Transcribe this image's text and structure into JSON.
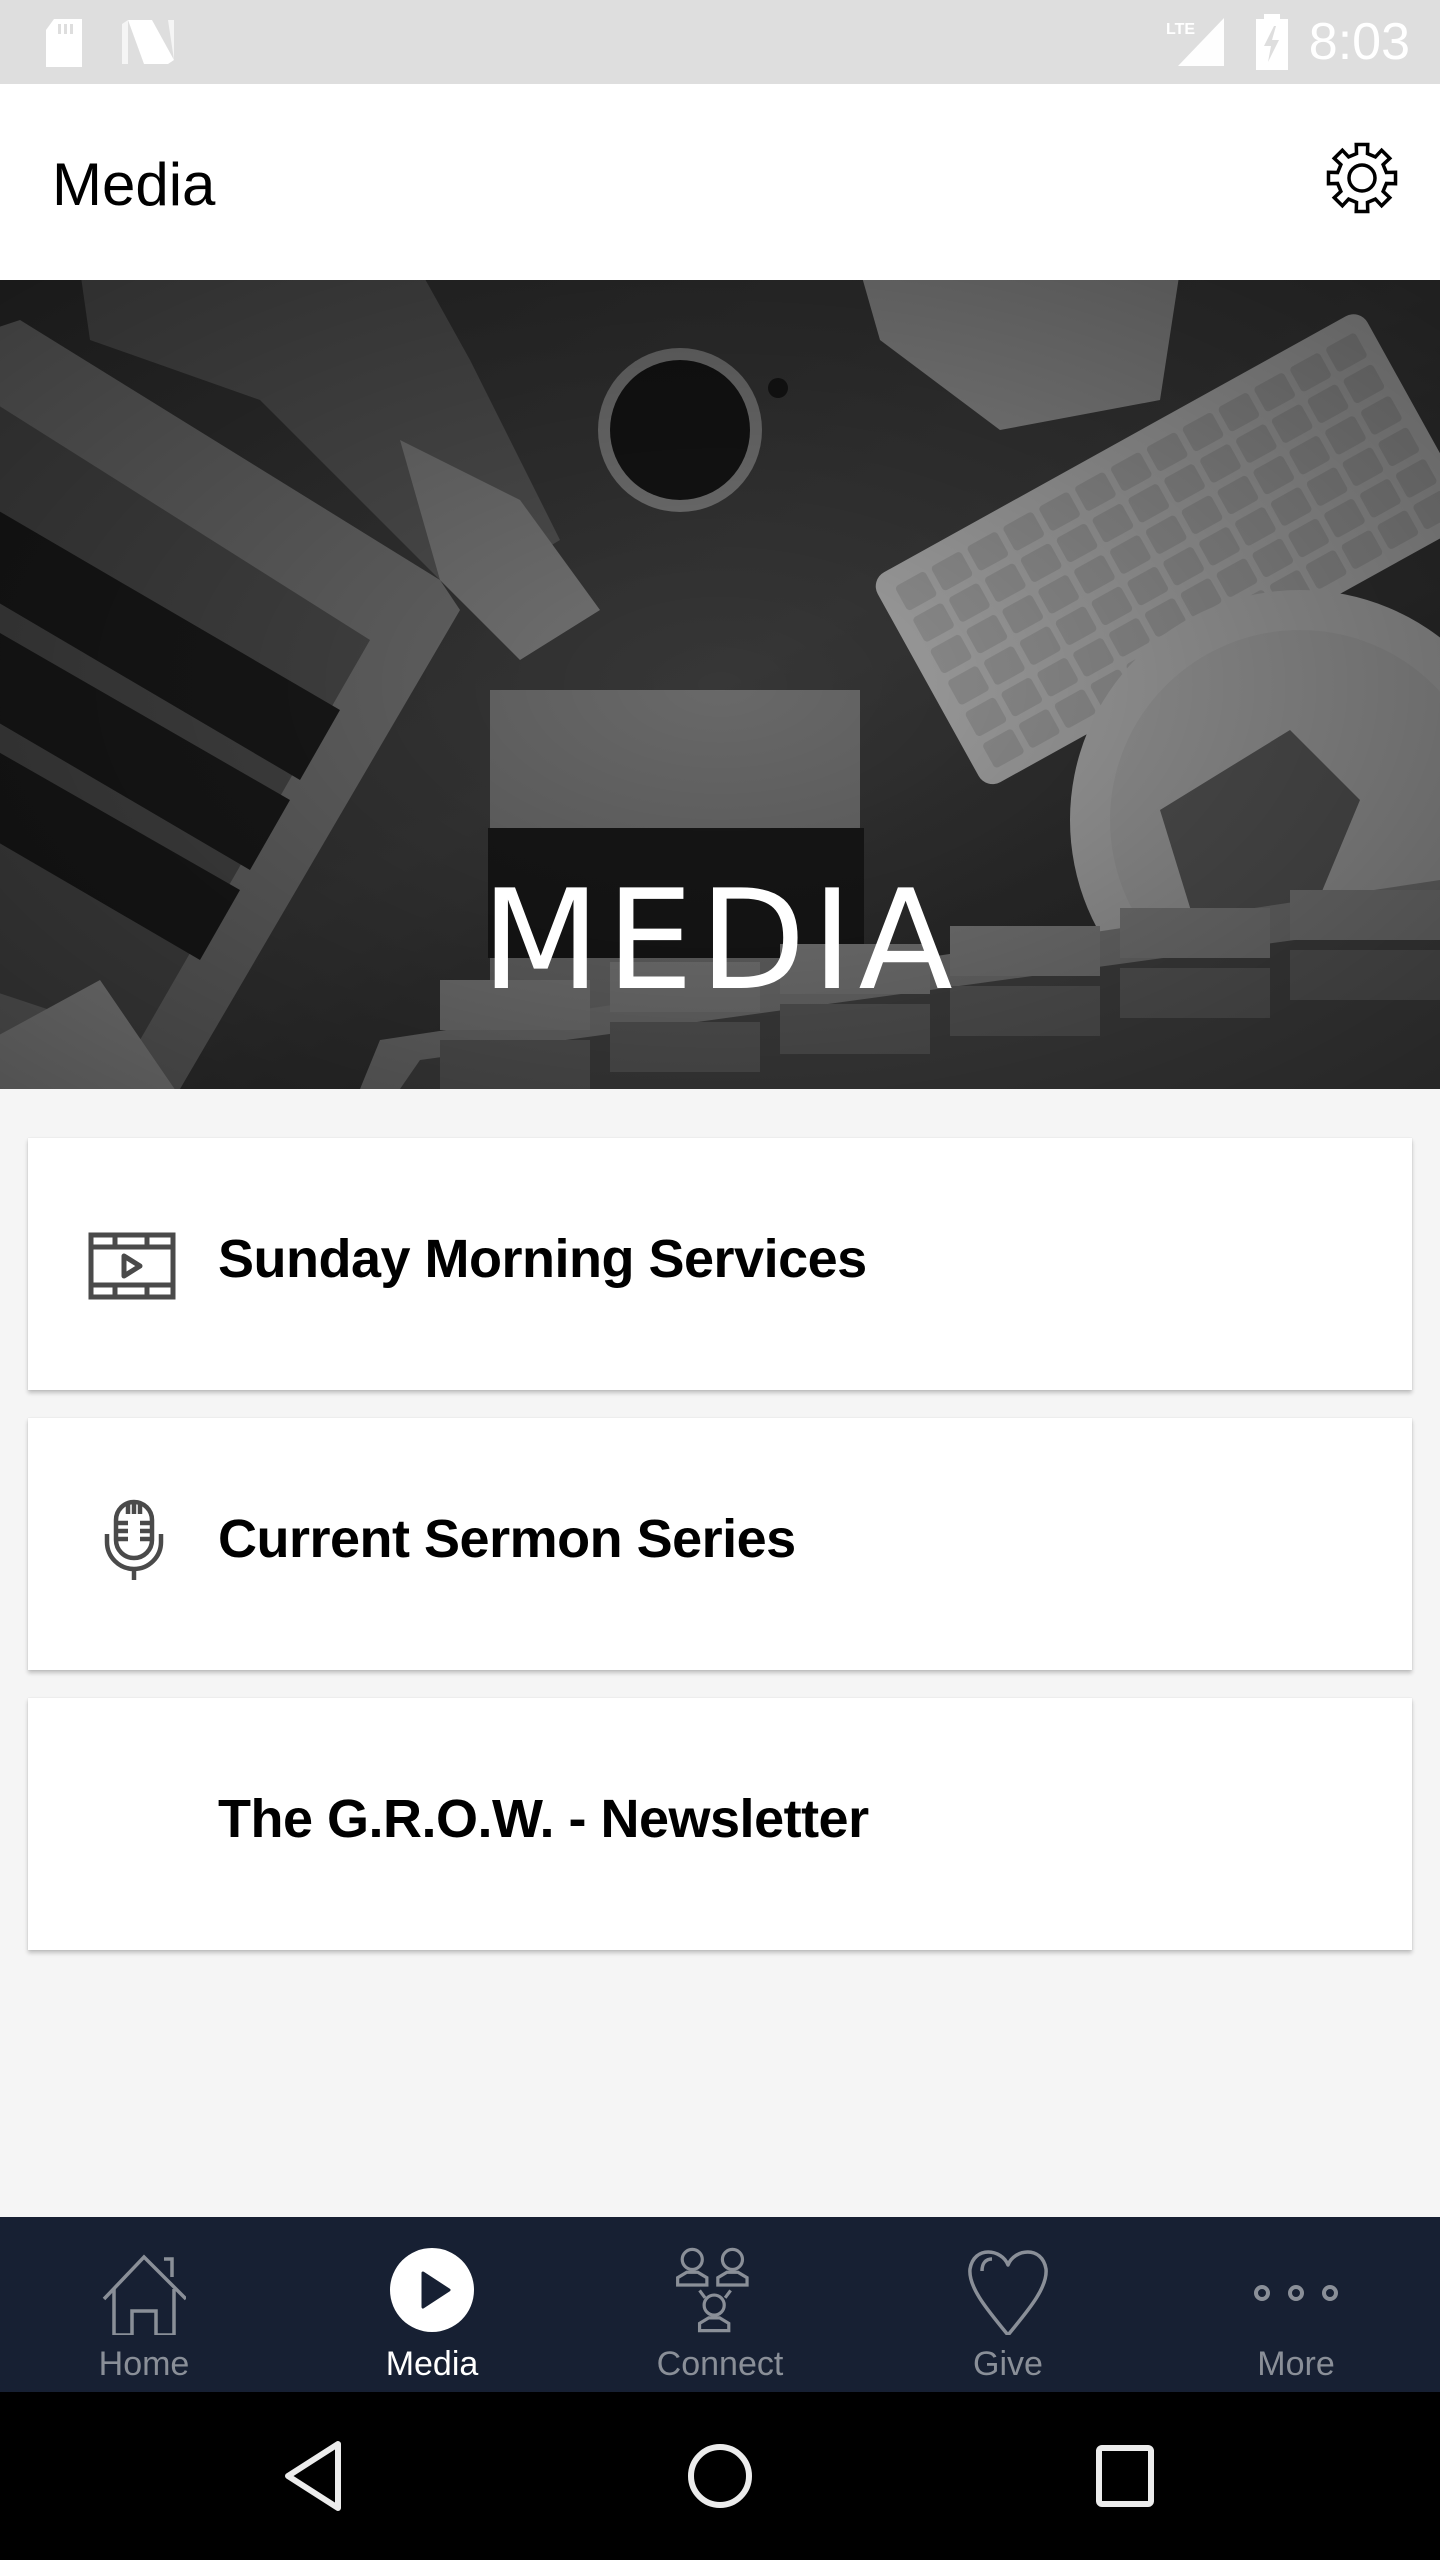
{
  "status_bar": {
    "time": "8:03",
    "network_label": "LTE",
    "icons": [
      "sd-card-icon",
      "n-notification-icon",
      "lte-signal-icon",
      "battery-charging-icon"
    ]
  },
  "toolbar": {
    "title": "Media",
    "settings_icon": "gear-icon"
  },
  "hero": {
    "title": "MEDIA",
    "image_description": "grayscale desk photo with laptop, coffee cup, keyboard, tablet and plate"
  },
  "cards": [
    {
      "label": "Sunday Morning Services",
      "icon": "film-play-icon"
    },
    {
      "label": "Current Sermon Series",
      "icon": "microphone-icon"
    },
    {
      "label": "The G.R.O.W. - Newsletter",
      "icon": ""
    }
  ],
  "bottom_nav": {
    "items": [
      {
        "label": "Home",
        "icon": "home-icon",
        "active": false
      },
      {
        "label": "Media",
        "icon": "play-circle-icon",
        "active": true
      },
      {
        "label": "Connect",
        "icon": "group-icon",
        "active": false
      },
      {
        "label": "Give",
        "icon": "heart-icon",
        "active": false
      },
      {
        "label": "More",
        "icon": "more-dots-icon",
        "active": false
      }
    ]
  },
  "system_nav": {
    "buttons": [
      "back",
      "home",
      "recents"
    ]
  },
  "colors": {
    "nav_background": "#172033",
    "nav_inactive": "#8a8f98",
    "nav_active": "#ffffff",
    "status_bar": "#dedede",
    "page_background": "#f5f5f5"
  }
}
